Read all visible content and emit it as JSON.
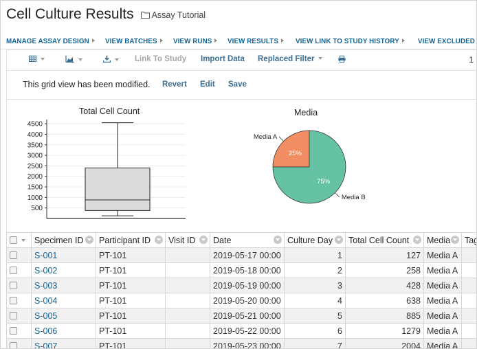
{
  "header": {
    "title": "Cell Culture Results",
    "folder": "Assay Tutorial",
    "nav": [
      "MANAGE ASSAY DESIGN",
      "VIEW BATCHES",
      "VIEW RUNS",
      "VIEW RESULTS",
      "VIEW LINK TO STUDY HISTORY",
      "VIEW EXCLUDED DATA"
    ]
  },
  "toolbar": {
    "link_to_study": "Link To Study",
    "import_data": "Import Data",
    "replaced_filter": "Replaced Filter",
    "page_number": "1"
  },
  "modified": {
    "message": "This grid view has been modified.",
    "revert": "Revert",
    "edit": "Edit",
    "save": "Save"
  },
  "chart_data": [
    {
      "type": "box",
      "title": "Total Cell Count",
      "yticks": [
        500,
        1000,
        1500,
        2000,
        2500,
        3000,
        3500,
        4000,
        4500
      ],
      "ylim": [
        0,
        4700
      ],
      "box": {
        "min": 127,
        "q1": 380,
        "median": 880,
        "q3": 2400,
        "max": 4550
      },
      "grid": true
    },
    {
      "type": "pie",
      "title": "Media",
      "slices": [
        {
          "label": "Media A",
          "value": 25,
          "pct_label": "25%",
          "color": "#f28e63"
        },
        {
          "label": "Media B",
          "value": 75,
          "pct_label": "75%",
          "color": "#66c2a5"
        }
      ]
    }
  ],
  "grid": {
    "columns": [
      "Specimen ID",
      "Participant ID",
      "Visit ID",
      "Date",
      "Culture Day",
      "Total Cell Count",
      "Media",
      "Tag"
    ],
    "rows": [
      [
        "S-001",
        "PT-101",
        "",
        "2019-05-17 00:00",
        "1",
        "127",
        "Media A",
        ""
      ],
      [
        "S-002",
        "PT-101",
        "",
        "2019-05-18 00:00",
        "2",
        "258",
        "Media A",
        ""
      ],
      [
        "S-003",
        "PT-101",
        "",
        "2019-05-19 00:00",
        "3",
        "428",
        "Media A",
        ""
      ],
      [
        "S-004",
        "PT-101",
        "",
        "2019-05-20 00:00",
        "4",
        "638",
        "Media A",
        ""
      ],
      [
        "S-005",
        "PT-101",
        "",
        "2019-05-21 00:00",
        "5",
        "885",
        "Media A",
        ""
      ],
      [
        "S-006",
        "PT-101",
        "",
        "2019-05-22 00:00",
        "6",
        "1279",
        "Media A",
        ""
      ],
      [
        "S-007",
        "PT-101",
        "",
        "2019-05-23 00:00",
        "7",
        "2004",
        "Media A",
        ""
      ]
    ]
  }
}
